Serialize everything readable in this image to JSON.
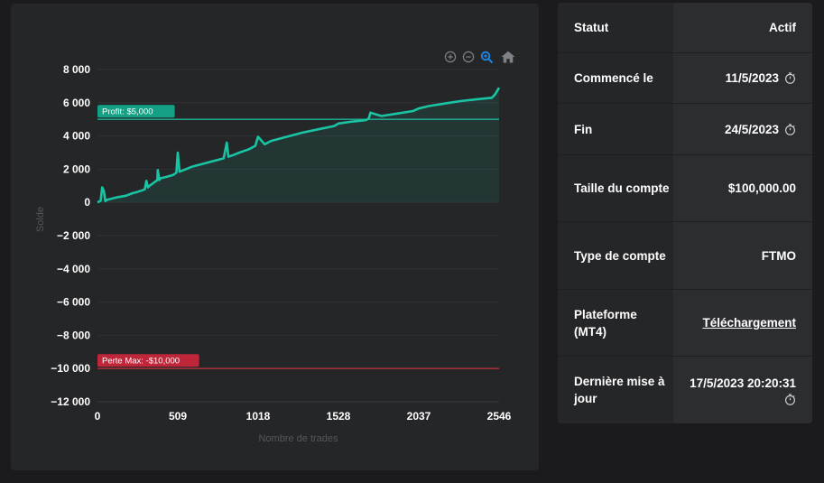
{
  "chart_data": {
    "type": "line",
    "xlabel": "Nombre de trades",
    "ylabel": "Solde",
    "xlim": [
      0,
      2546
    ],
    "ylim": [
      -12000,
      8000
    ],
    "x_ticks": [
      "0",
      "509",
      "1018",
      "1528",
      "2037",
      "2546"
    ],
    "y_ticks": [
      "8 000",
      "6 000",
      "4 000",
      "2 000",
      "0",
      "−2 000",
      "−4 000",
      "−6 000",
      "−8 000",
      "−10 000",
      "−12 000"
    ],
    "grid": true,
    "series": [
      {
        "color": "#19c4a4",
        "x": [
          0,
          20,
          30,
          40,
          50,
          60,
          120,
          180,
          220,
          260,
          300,
          310,
          320,
          330,
          380,
          382,
          392,
          400,
          440,
          480,
          500,
          509,
          520,
          560,
          600,
          700,
          800,
          820,
          830,
          860,
          900,
          960,
          1000,
          1018,
          1060,
          1100,
          1200,
          1300,
          1400,
          1500,
          1528,
          1600,
          1700,
          1720,
          1730,
          1800,
          1900,
          2000,
          2037,
          2100,
          2200,
          2300,
          2400,
          2500,
          2520,
          2546
        ],
        "y": [
          0,
          100,
          900,
          700,
          80,
          150,
          300,
          400,
          550,
          650,
          780,
          1300,
          900,
          1000,
          1350,
          1950,
          1350,
          1450,
          1550,
          1650,
          1800,
          3000,
          1850,
          2000,
          2150,
          2400,
          2650,
          3600,
          2750,
          2850,
          3000,
          3200,
          3400,
          3950,
          3500,
          3700,
          3950,
          4200,
          4400,
          4600,
          4750,
          4850,
          4950,
          5050,
          5400,
          5200,
          5350,
          5500,
          5650,
          5800,
          5950,
          6100,
          6200,
          6300,
          6500,
          6900
        ]
      }
    ],
    "annotations": [
      {
        "label": "Profit: $5,000",
        "y": 5000,
        "color": "#13a085",
        "line_color": "#20b59a"
      },
      {
        "label": "Perte Max: -$10,000",
        "y": -10000,
        "color": "#c0263a",
        "line_color": "#b5303c"
      }
    ]
  },
  "toolbar": {
    "icons": [
      "zoom-in-icon",
      "zoom-out-icon",
      "magnifier-icon",
      "home-icon"
    ],
    "active_color": "#1e88e5"
  },
  "info": {
    "rows": [
      {
        "label": "Statut",
        "value": "Actif"
      },
      {
        "label": "Commencé le",
        "value": "11/5/2023",
        "icon": "timer-icon"
      },
      {
        "label": "Fin",
        "value": "24/5/2023",
        "icon": "timer-icon"
      },
      {
        "label": "Taille du compte",
        "value": "$100,000.00"
      },
      {
        "label": "Type de compte",
        "value": "FTMO"
      },
      {
        "label": "Plateforme (MT4)",
        "value": "Téléchargement",
        "link": true
      },
      {
        "label": "Dernière mise à jour",
        "value": "17/5/2023 20:20:31",
        "icon": "timer-icon"
      }
    ]
  }
}
